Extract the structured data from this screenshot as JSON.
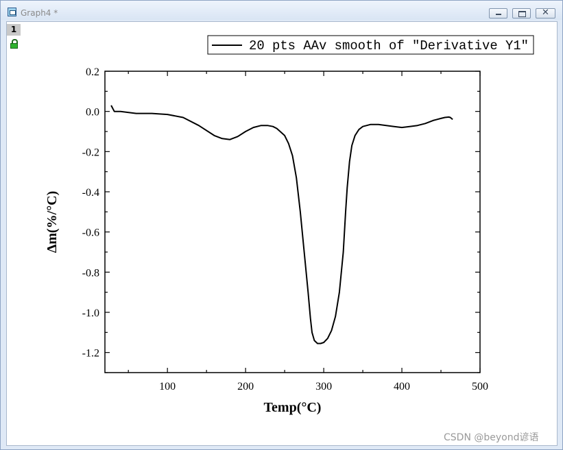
{
  "window": {
    "title": "Graph4 *",
    "close_glyph": "✕"
  },
  "layer_tab": "1",
  "watermark": "CSDN @beyond谚语",
  "chart_data": {
    "type": "line",
    "title": "",
    "xlabel": "Temp(°C)",
    "ylabel": "Δm(%/°C)",
    "xlim": [
      20,
      500
    ],
    "ylim": [
      -1.3,
      0.2
    ],
    "x_ticks": [
      100,
      200,
      300,
      400,
      500
    ],
    "x_tick_labels": [
      "100",
      "200",
      "300",
      "400",
      "500"
    ],
    "y_ticks": [
      0.2,
      0.0,
      -0.2,
      -0.4,
      -0.6,
      -0.8,
      -1.0,
      -1.2
    ],
    "y_tick_labels": [
      "0.2",
      "0.0",
      "-0.2",
      "-0.4",
      "-0.6",
      "-0.8",
      "-1.0",
      "-1.2"
    ],
    "grid": false,
    "legend_position": "top-right",
    "colors": {
      "line": "#000000"
    },
    "series": [
      {
        "name": "20 pts AAv smooth of \"Derivative Y1\"",
        "x": [
          28,
          32,
          40,
          60,
          80,
          100,
          120,
          140,
          160,
          170,
          180,
          190,
          200,
          210,
          220,
          228,
          235,
          240,
          250,
          255,
          260,
          265,
          270,
          275,
          280,
          283,
          285,
          288,
          292,
          296,
          300,
          305,
          310,
          315,
          320,
          325,
          328,
          330,
          333,
          336,
          340,
          345,
          350,
          360,
          370,
          380,
          390,
          400,
          410,
          420,
          430,
          440,
          450,
          455,
          460,
          462,
          465
        ],
        "y": [
          0.03,
          0.0,
          0.0,
          -0.01,
          -0.01,
          -0.015,
          -0.03,
          -0.07,
          -0.12,
          -0.135,
          -0.14,
          -0.125,
          -0.1,
          -0.08,
          -0.07,
          -0.07,
          -0.075,
          -0.085,
          -0.12,
          -0.16,
          -0.22,
          -0.33,
          -0.5,
          -0.7,
          -0.9,
          -1.03,
          -1.1,
          -1.14,
          -1.155,
          -1.155,
          -1.15,
          -1.13,
          -1.09,
          -1.02,
          -0.9,
          -0.7,
          -0.5,
          -0.38,
          -0.25,
          -0.17,
          -0.12,
          -0.09,
          -0.075,
          -0.065,
          -0.065,
          -0.07,
          -0.075,
          -0.08,
          -0.075,
          -0.07,
          -0.06,
          -0.045,
          -0.035,
          -0.03,
          -0.028,
          -0.03,
          -0.04
        ]
      }
    ]
  }
}
